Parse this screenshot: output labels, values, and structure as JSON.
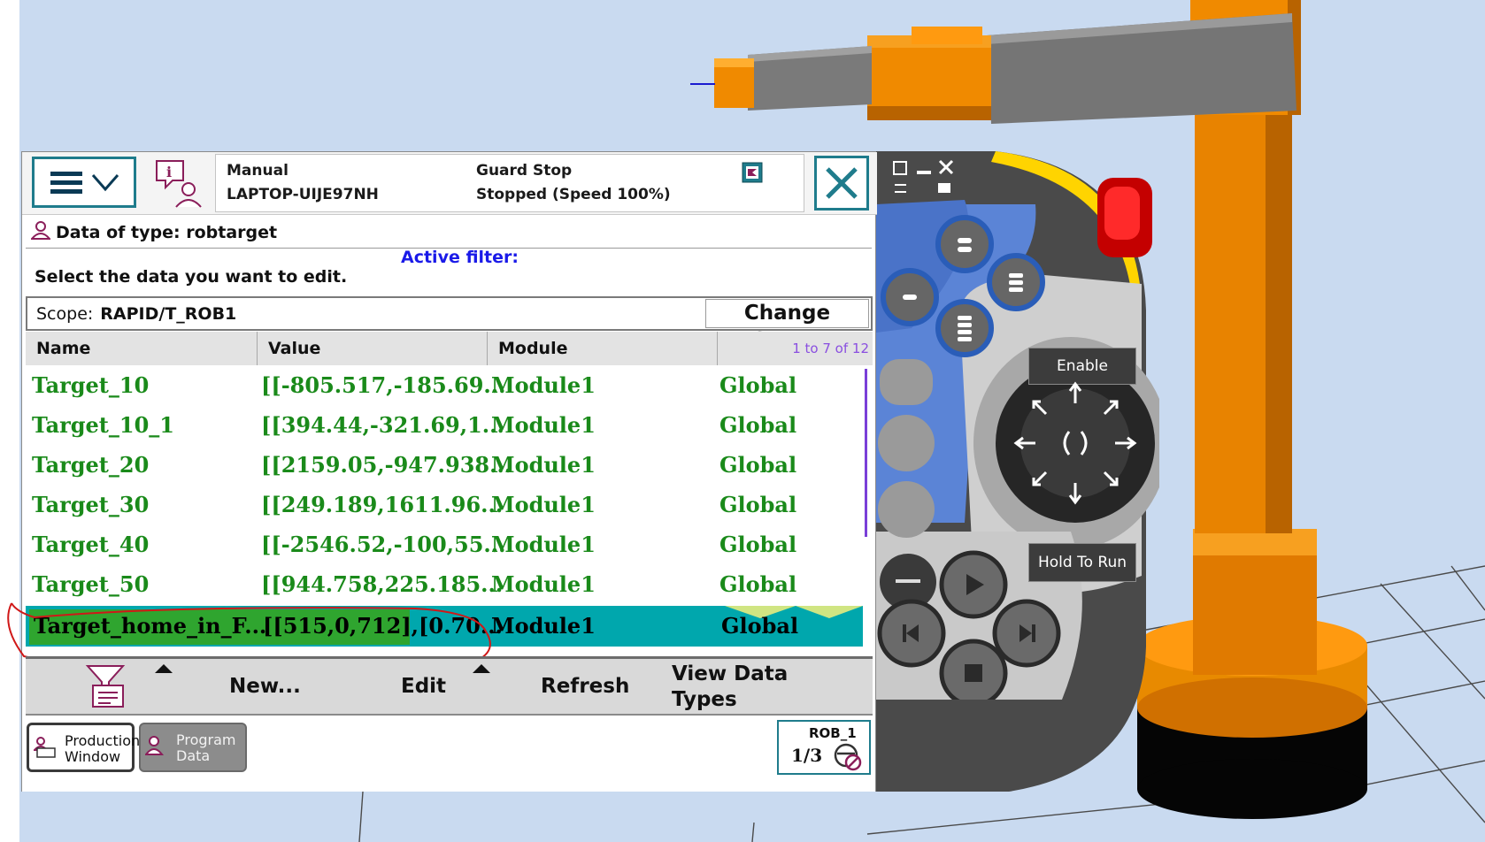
{
  "window": {
    "mode": "Manual",
    "host": "LAPTOP-UIJE97NH",
    "guard": "Guard Stop",
    "state": "Stopped (Speed 100%)"
  },
  "header": {
    "title": "Data of type: robtarget",
    "active_filter": "Active filter:",
    "instruction": "Select the data you want to edit."
  },
  "scope": {
    "label": "Scope:",
    "value": "RAPID/T_ROB1",
    "change_button": "Change Scope"
  },
  "table": {
    "columns": [
      "Name",
      "Value",
      "Module"
    ],
    "count": "1 to 7 of 12",
    "rows": [
      {
        "name": "Target_10",
        "value": "[[-805.517,-185.69...",
        "module": "Module1",
        "scope": "Global",
        "selected": false
      },
      {
        "name": "Target_10_1",
        "value": "[[394.44,-321.69,1...",
        "module": "Module1",
        "scope": "Global",
        "selected": false
      },
      {
        "name": "Target_20",
        "value": "[[2159.05,-947.938...",
        "module": "Module1",
        "scope": "Global",
        "selected": false
      },
      {
        "name": "Target_30",
        "value": "[[249.189,1611.96...",
        "module": "Module1",
        "scope": "Global",
        "selected": false
      },
      {
        "name": "Target_40",
        "value": "[[-2546.52,-100,55...",
        "module": "Module1",
        "scope": "Global",
        "selected": false
      },
      {
        "name": "Target_50",
        "value": "[[944.758,225.185...",
        "module": "Module1",
        "scope": "Global",
        "selected": false
      },
      {
        "name": "Target_home_in_F...",
        "value": "[[515,0,712],[0.70...",
        "module": "Module1",
        "scope": "Global",
        "selected": true
      }
    ]
  },
  "toolbar": {
    "new": "New...",
    "edit": "Edit",
    "refresh": "Refresh",
    "view_line1": "View Data",
    "view_line2": "Types"
  },
  "taskbar": {
    "production": "Production\nWindow",
    "program": "Program\nData",
    "rob": "ROB_1",
    "speed": "1/3"
  },
  "hardware": {
    "enable": "Enable",
    "hold": "Hold To Run"
  },
  "colors": {
    "accent": "#1f7c8c",
    "selected_row": "#00a7ad",
    "row_text": "#1a8a1a",
    "robot_orange": "#f08a00",
    "robot_gray": "#707070"
  }
}
